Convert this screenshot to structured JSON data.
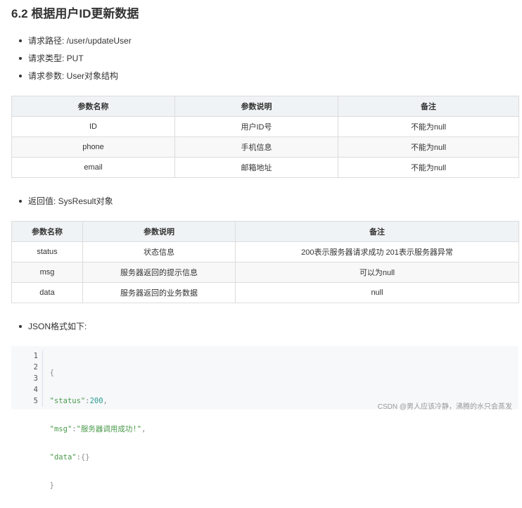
{
  "heading": "6.2 根据用户ID更新数据",
  "request_info": [
    "请求路径: /user/updateUser",
    "请求类型: PUT",
    "请求参数: User对象结构"
  ],
  "params_table": {
    "headers": [
      "参数名称",
      "参数说明",
      "备注"
    ],
    "rows": [
      [
        "ID",
        "用户ID号",
        "不能为null"
      ],
      [
        "phone",
        "手机信息",
        "不能为null"
      ],
      [
        "email",
        "邮箱地址",
        "不能为null"
      ]
    ]
  },
  "return_info": "返回值: SysResult对象",
  "result_table": {
    "headers": [
      "参数名称",
      "参数说明",
      "备注"
    ],
    "rows": [
      [
        "status",
        "状态信息",
        "200表示服务器请求成功 201表示服务器异常"
      ],
      [
        "msg",
        "服务器返回的提示信息",
        "可以为null"
      ],
      [
        "data",
        "服务器返回的业务数据",
        "null"
      ]
    ]
  },
  "json_format_label": "JSON格式如下:",
  "code": {
    "line_numbers": [
      "1",
      "2",
      "3",
      "4",
      "5"
    ],
    "lines": [
      {
        "open": "{"
      },
      {
        "key": "\"status\"",
        "sep": ":",
        "value": "200",
        "tail": ","
      },
      {
        "key": "\"msg\"",
        "sep": ":",
        "value": "\"服务器调用成功!\"",
        "tail": ","
      },
      {
        "key": "\"data\"",
        "sep": ":",
        "value": "{}",
        "tail": ""
      },
      {
        "open": "}"
      }
    ]
  },
  "watermark": "CSDN @男人应该冷静，沸腾的水只会蒸发"
}
